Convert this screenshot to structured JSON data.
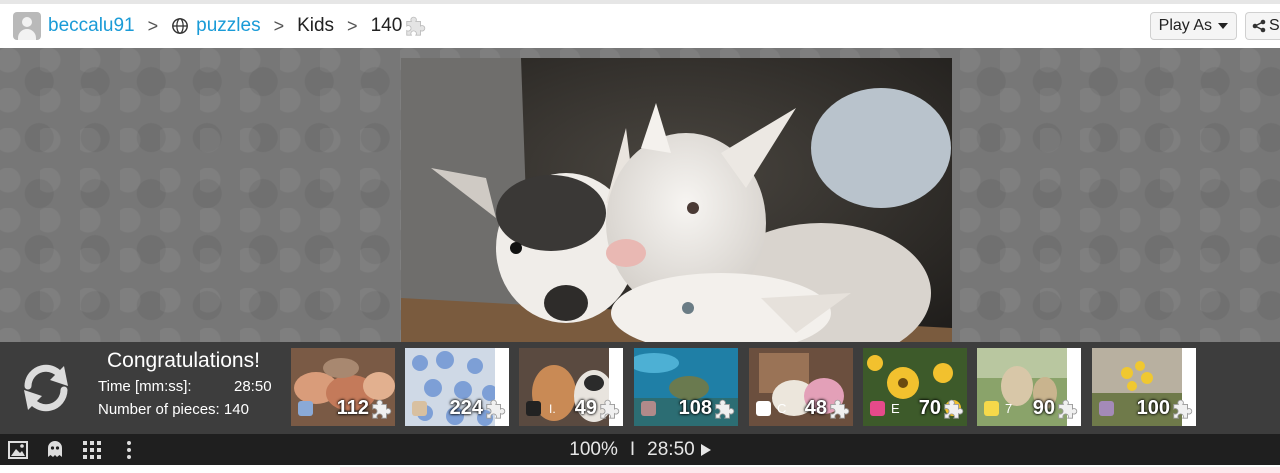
{
  "breadcrumb": {
    "user": "beccalu91",
    "section": "puzzles",
    "category": "Kids",
    "pieces": "140"
  },
  "header": {
    "play_as_label": "Play As",
    "share_label": "S"
  },
  "completion": {
    "title": "Congratulations!",
    "time_label": "Time [mm:ss]:",
    "time_value": "28:50",
    "pieces_label": "Number of pieces:",
    "pieces_value": "140"
  },
  "thumbnails": [
    {
      "count": "112",
      "badge_text": "",
      "subject": "pigs and puppy"
    },
    {
      "count": "224",
      "badge_text": "",
      "subject": "blue flowers"
    },
    {
      "count": "49",
      "badge_text": "I.",
      "subject": "goats"
    },
    {
      "count": "108",
      "badge_text": "",
      "subject": "sea turtle"
    },
    {
      "count": "48",
      "badge_text": "C",
      "subject": "lambs"
    },
    {
      "count": "70",
      "badge_text": "E",
      "subject": "yellow flowers"
    },
    {
      "count": "90",
      "badge_text": "7",
      "subject": "goats on grass"
    },
    {
      "count": "100",
      "badge_text": "",
      "subject": "wildflowers"
    }
  ],
  "status": {
    "zoom": "100%",
    "divider": "I",
    "timer": "28:50"
  },
  "icons": {
    "replay": "replay-icon",
    "image": "image-icon",
    "ghost": "ghost-icon",
    "grid": "grid-icon",
    "more": "more-vertical-icon"
  },
  "colors": {
    "link": "#1a9bd7",
    "panel": "#3d3d3d",
    "toolbar": "#1f1f1f"
  }
}
